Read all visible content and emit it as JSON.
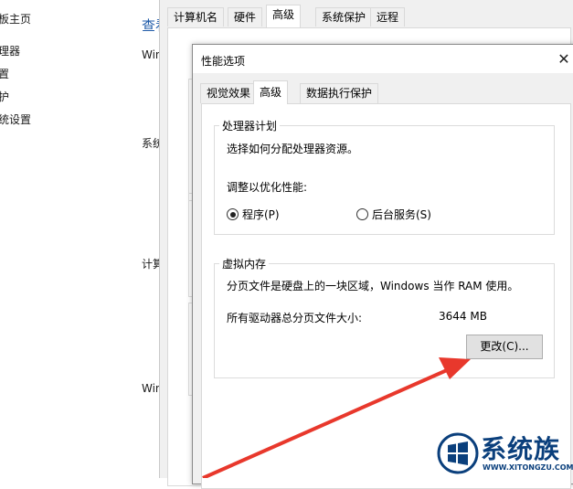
{
  "control_panel": {
    "nav_items": [
      "板主页",
      "理器",
      "置",
      "护",
      "统设置"
    ],
    "title": "查看",
    "side_labels": [
      "Win",
      "系统",
      "计算",
      "Win"
    ]
  },
  "system_properties": {
    "tabs": [
      "计算机名",
      "硬件",
      "高级",
      "系统保护",
      "远程"
    ],
    "active_tab": "高级"
  },
  "performance_options": {
    "title": "性能选项",
    "close_label": "✕",
    "tabs": [
      "视觉效果",
      "高级",
      "数据执行保护"
    ],
    "active_tab": "高级",
    "processor": {
      "legend": "处理器计划",
      "description": "选择如何分配处理器资源。",
      "adjust_label": "调整以优化性能:",
      "option_programs": "程序(P)",
      "option_background": "后台服务(S)",
      "selected": "程序(P)"
    },
    "virtual_memory": {
      "legend": "虚拟内存",
      "description": "分页文件是硬盘上的一块区域，Windows 当作 RAM 使用。",
      "total_label": "所有驱动器总分页文件大小:",
      "total_value": "3644 MB",
      "change_button": "更改(C)..."
    }
  },
  "watermark": {
    "name": "系统族",
    "url": "WWW.XITONGZU.COM",
    "color": "#0a3f7c"
  },
  "annotation": {
    "arrow_color": "#e8382c"
  }
}
